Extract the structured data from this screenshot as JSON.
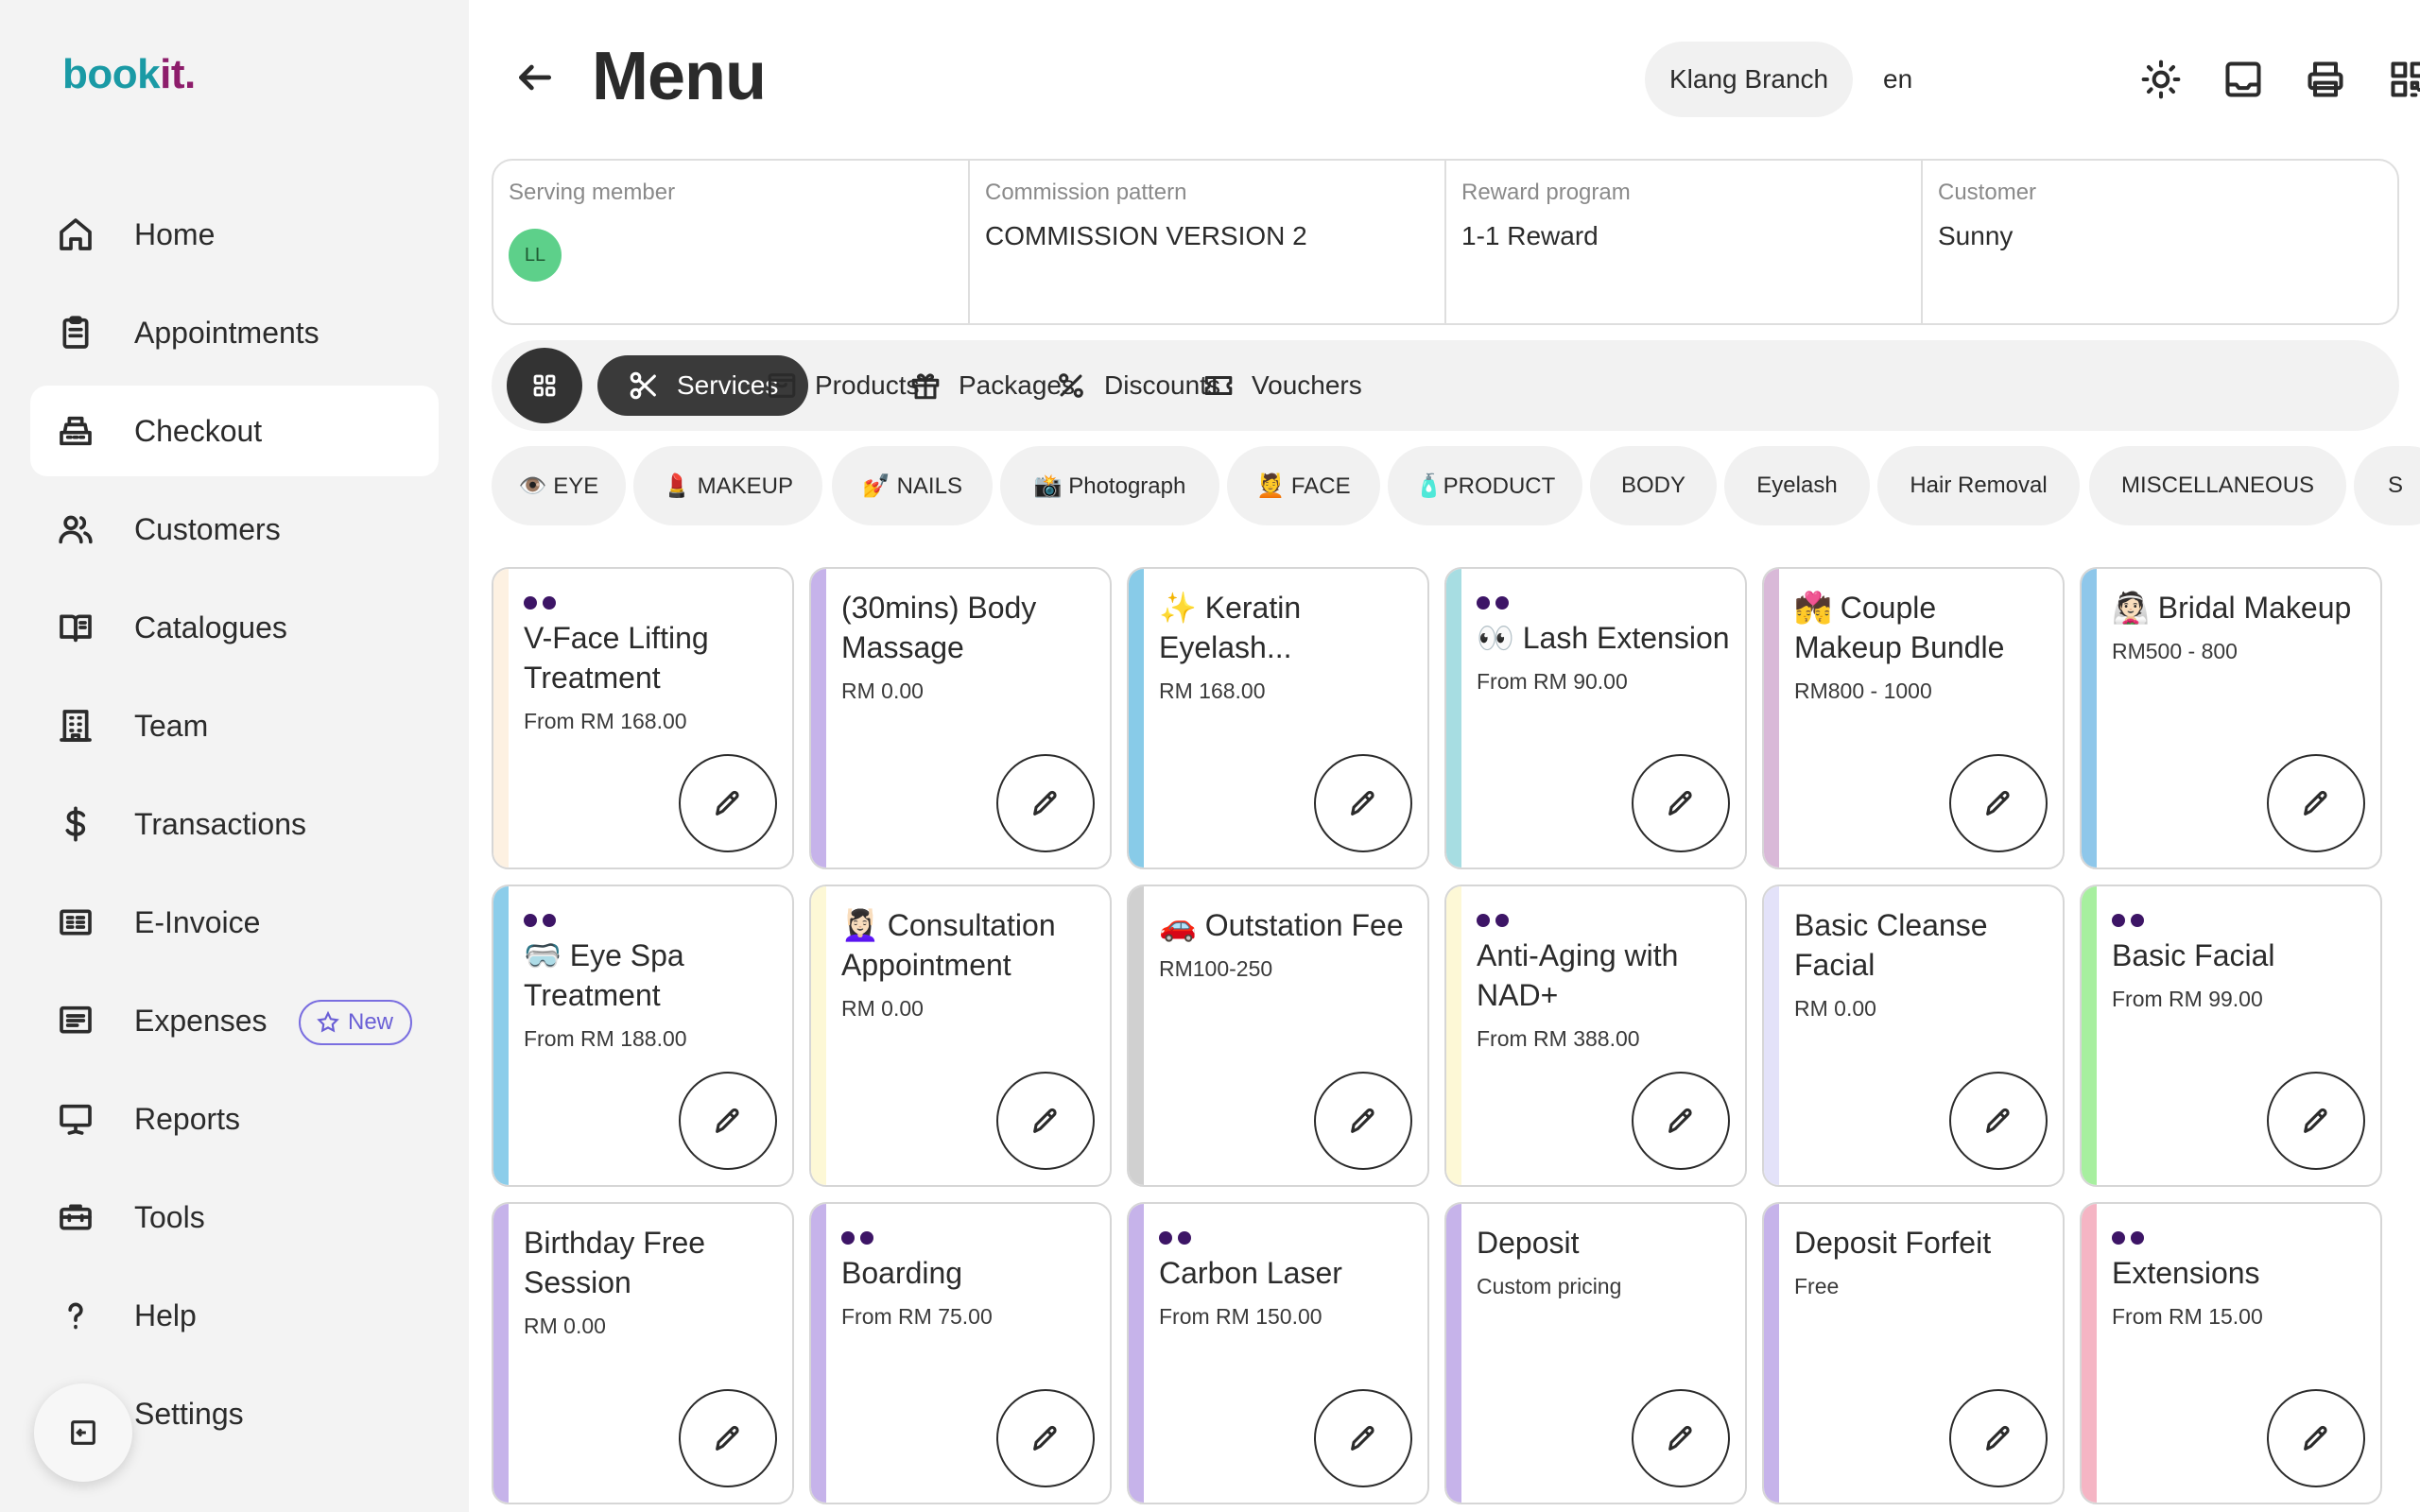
{
  "app": {
    "logo_part1": "book",
    "logo_part2": "it."
  },
  "sidebar": {
    "items": [
      {
        "label": "Home"
      },
      {
        "label": "Appointments"
      },
      {
        "label": "Checkout"
      },
      {
        "label": "Customers"
      },
      {
        "label": "Catalogues"
      },
      {
        "label": "Team"
      },
      {
        "label": "Transactions"
      },
      {
        "label": "E-Invoice"
      },
      {
        "label": "Expenses",
        "badge": "New"
      },
      {
        "label": "Reports"
      },
      {
        "label": "Tools"
      },
      {
        "label": "Help"
      },
      {
        "label": "Settings"
      }
    ],
    "active": "Checkout"
  },
  "header": {
    "title": "Menu",
    "branch": "Klang Branch",
    "language": "en"
  },
  "info": {
    "serving_member": {
      "label": "Serving member",
      "initials": "LL"
    },
    "commission": {
      "label": "Commission pattern",
      "value": "COMMISSION VERSION 2"
    },
    "reward": {
      "label": "Reward program",
      "value": "1-1 Reward"
    },
    "customer": {
      "label": "Customer",
      "value": "Sunny"
    }
  },
  "tabs": [
    {
      "label": "Services",
      "icon": "scissors-icon",
      "active": true
    },
    {
      "label": "Products",
      "icon": "box-icon"
    },
    {
      "label": "Packages",
      "icon": "gift-icon"
    },
    {
      "label": "Discounts",
      "icon": "percent-icon"
    },
    {
      "label": "Vouchers",
      "icon": "ticket-icon"
    }
  ],
  "categories": [
    "👁️ EYE",
    "💄 MAKEUP",
    "💅 NAILS",
    "📸 Photograph",
    "💆 FACE",
    "🧴PRODUCT",
    "BODY",
    "Eyelash",
    "Hair Removal",
    "MISCELLANEOUS",
    "S"
  ],
  "services": [
    {
      "name": "V-Face Lifting Treatment",
      "price": "From RM 168.00",
      "dots": true,
      "color": "#fdf1e2"
    },
    {
      "name": "(30mins) Body Massage",
      "price": "RM 0.00",
      "dots": false,
      "color": "#c6b3ea"
    },
    {
      "name": "✨ Keratin Eyelash...",
      "price": "RM 168.00",
      "dots": false,
      "color": "#88cbe8"
    },
    {
      "name": "👀 Lash Extension",
      "price": "From RM 90.00",
      "dots": true,
      "color": "#a7dde2"
    },
    {
      "name": "💏 Couple Makeup Bundle",
      "price": "RM800 - 1000",
      "dots": false,
      "color": "#d9b9d8"
    },
    {
      "name": "👰🏻 Bridal Makeup",
      "price": "RM500 - 800",
      "dots": false,
      "color": "#8ec7ea"
    },
    {
      "name": "🥽 Eye Spa Treatment",
      "price": "From RM 188.00",
      "dots": true,
      "color": "#8ccdea"
    },
    {
      "name": "💆🏻‍♀️ Consultation Appointment",
      "price": "RM 0.00",
      "dots": false,
      "color": "#fdf8d6"
    },
    {
      "name": "🚗 Outstation Fee",
      "price": "RM100-250",
      "dots": false,
      "color": "#d0d0d0"
    },
    {
      "name": "Anti-Aging with NAD+",
      "price": "From RM 388.00",
      "dots": true,
      "color": "#fdf8d6"
    },
    {
      "name": "Basic Cleanse Facial",
      "price": "RM 0.00",
      "dots": false,
      "color": "#e3e2f9"
    },
    {
      "name": "Basic Facial",
      "price": "From RM 99.00",
      "dots": true,
      "color": "#a7ef9f"
    },
    {
      "name": "Birthday Free Session",
      "price": "RM 0.00",
      "dots": false,
      "color": "#c6b3ea"
    },
    {
      "name": "Boarding",
      "price": "From RM 75.00",
      "dots": true,
      "color": "#c6b3ea"
    },
    {
      "name": "Carbon Laser",
      "price": "From RM 150.00",
      "dots": true,
      "color": "#c6b3ea"
    },
    {
      "name": "Deposit",
      "price": "Custom pricing",
      "dots": false,
      "color": "#c6b3ea"
    },
    {
      "name": "Deposit Forfeit",
      "price": "Free",
      "dots": false,
      "color": "#c6b3ea"
    },
    {
      "name": "Extensions",
      "price": "From RM 15.00",
      "dots": true,
      "color": "#f5b5c4"
    }
  ]
}
